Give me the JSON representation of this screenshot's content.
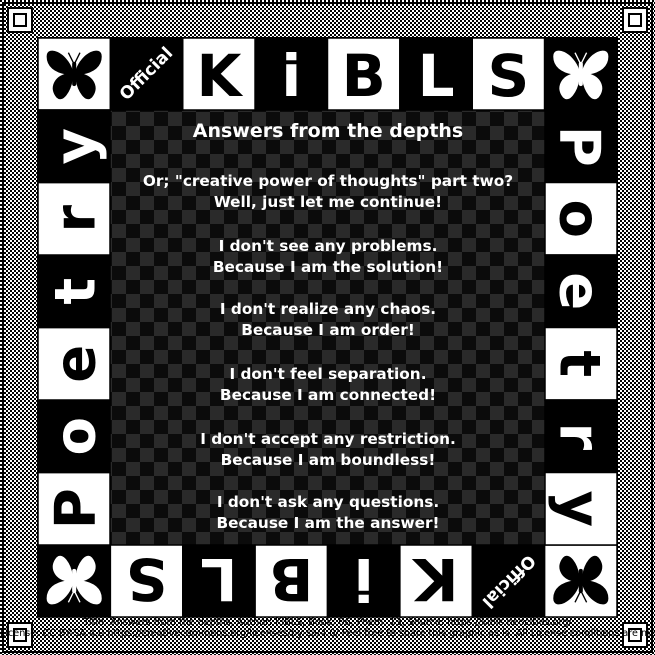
{
  "header": {
    "brand_letters": [
      "K",
      "i",
      "B",
      "L",
      "S"
    ],
    "official_label": "Official"
  },
  "side": {
    "word_letters": [
      "P",
      "o",
      "e",
      "t",
      "r",
      "y"
    ]
  },
  "icons": [
    "butterfly-icon"
  ],
  "colors": {
    "dark": "#000000",
    "light": "#ffffff"
  },
  "poem": {
    "title": "Answers from the depths",
    "stanzas": [
      {
        "line1": "Or; \"creative power of thoughts\" part two?",
        "line2": "Well, just let me continue!"
      },
      {
        "line1": "I don't see any problems.",
        "line2": "Because I am the solution!"
      },
      {
        "line1": "I don't realize any chaos.",
        "line2": "Because I am order!"
      },
      {
        "line1": "I don't feel separation.",
        "line2": "Because I am connected!"
      },
      {
        "line1": "I don't accept any restriction.",
        "line2": "Because I am boundless!"
      },
      {
        "line1": "I don't ask any questions.",
        "line2": "Because I am the answer!"
      }
    ]
  },
  "footer": {
    "line1": "Title: Answers from the depths, Author: KiBLS, Book: 06, Poem: 13, Source: https://kibls.neocities.org/",
    "line2": "License: CC BY-SA 4.0 https://creativecommons.org/licenses/by-sa/4.0/ Feel free to share this graphic as is. All License conditions are met."
  }
}
